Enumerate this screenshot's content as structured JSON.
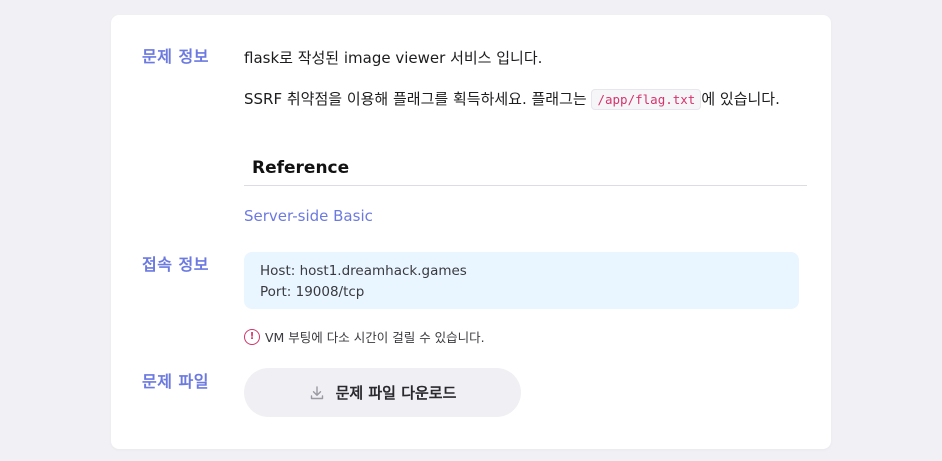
{
  "sections": {
    "problem_info": "문제 정보",
    "connection_info": "접속 정보",
    "problem_file": "문제 파일"
  },
  "description": {
    "line1": "flask로 작성된 image viewer 서비스 입니다.",
    "line2_before": "SSRF 취약점을 이용해 플래그를 획득하세요. 플래그는 ",
    "line2_code": "/app/flag.txt",
    "line2_after": "에 있습니다."
  },
  "reference": {
    "heading": "Reference",
    "link": "Server-side Basic"
  },
  "connection": {
    "host": "Host: host1.dreamhack.games",
    "port": "Port: 19008/tcp"
  },
  "vm_note": "VM 부팅에 다소 시간이 걸릴 수 있습니다.",
  "download_button": "문제 파일 다운로드",
  "colors": {
    "accent": "#6c7ae0",
    "code": "#d6336c",
    "info_box": "#eaf6ff",
    "button_bg": "#f0eff4"
  }
}
